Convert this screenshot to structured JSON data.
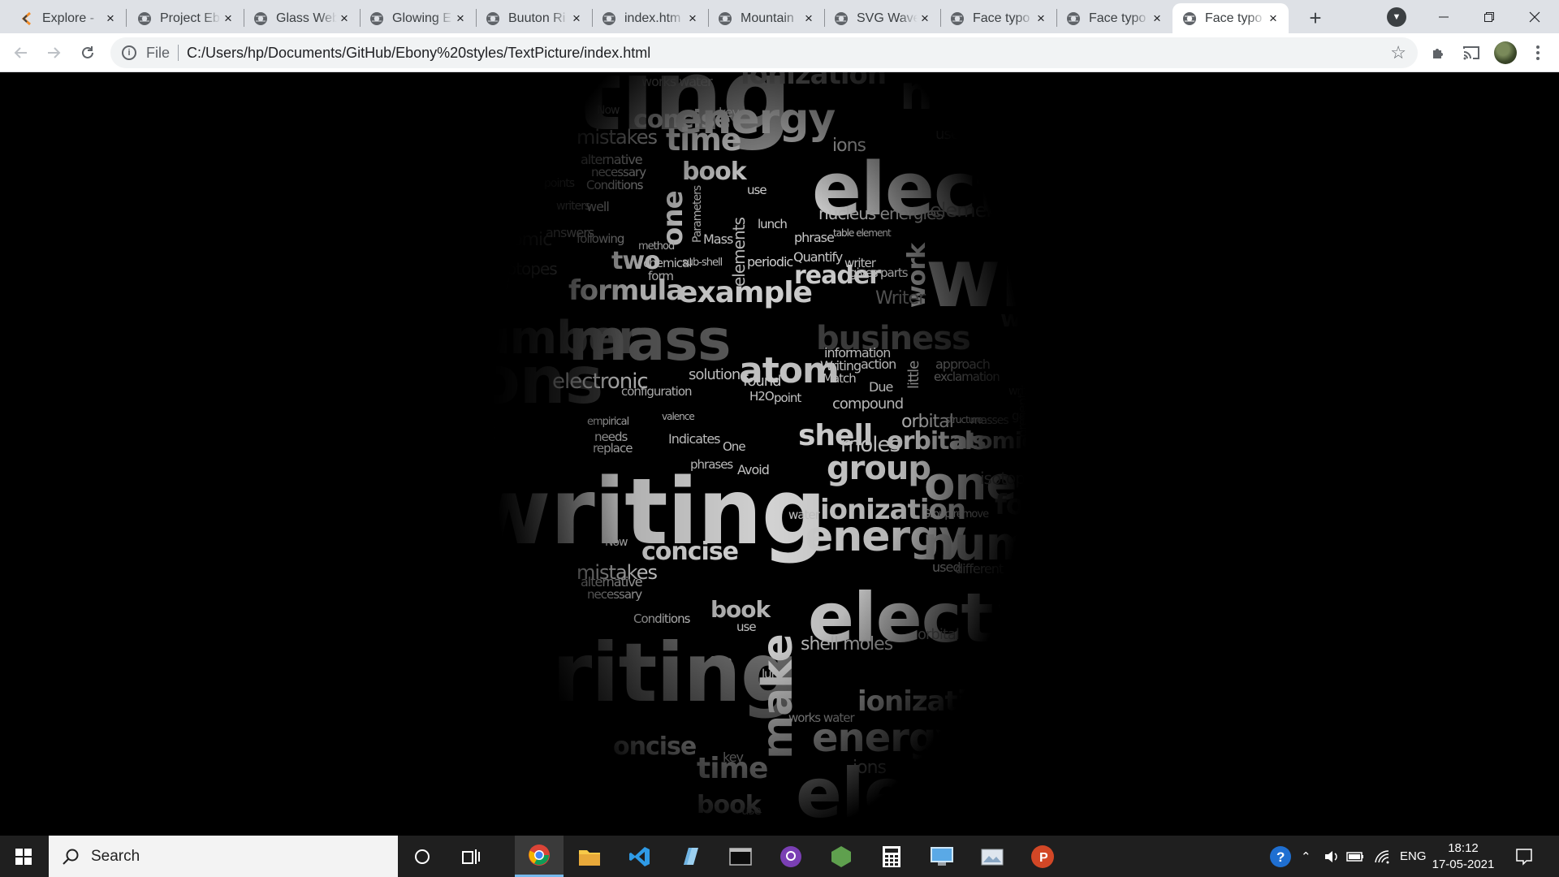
{
  "browser": {
    "tabs": [
      {
        "title": "Explore - ",
        "favicon": "explore-favicon",
        "active": false
      },
      {
        "title": "Project Eb",
        "favicon": "globe-icon",
        "active": false
      },
      {
        "title": "Glass Web",
        "favicon": "globe-icon",
        "active": false
      },
      {
        "title": "Glowing E",
        "favicon": "globe-icon",
        "active": false
      },
      {
        "title": "Buuton Ri",
        "favicon": "globe-icon",
        "active": false
      },
      {
        "title": "index.htm",
        "favicon": "globe-icon",
        "active": false
      },
      {
        "title": "Mountain",
        "favicon": "globe-icon",
        "active": false
      },
      {
        "title": "SVG Wave",
        "favicon": "globe-icon",
        "active": false
      },
      {
        "title": "Face typo",
        "favicon": "globe-icon",
        "active": false
      },
      {
        "title": "Face typo",
        "favicon": "globe-icon",
        "active": false
      },
      {
        "title": "Face typo",
        "favicon": "globe-icon",
        "active": true
      }
    ],
    "new_tab_symbol": "+",
    "address": {
      "scheme_chip": "File",
      "url": "C:/Users/hp/Documents/GitHub/Ebony%20styles/TextPicture/index.html"
    },
    "icons": [
      "back-icon",
      "forward-icon",
      "reload-icon",
      "info-icon",
      "star-icon",
      "extensions-icon",
      "cast-icon",
      "avatar",
      "menu-icon"
    ],
    "window_controls": [
      "minimize",
      "restore",
      "close"
    ]
  },
  "page": {
    "background": "#000000",
    "words": [
      {
        "t": "riting",
        "s": 120,
        "c": "#9a9a9a"
      },
      {
        "t": "works water",
        "s": 16,
        "c": "#bdbdbd"
      },
      {
        "t": "ionization",
        "s": 34,
        "c": "#8a8a8a"
      },
      {
        "t": "Now",
        "s": 14,
        "c": "#cfcfcf"
      },
      {
        "t": "concise",
        "s": 30,
        "c": "#d6d6d6"
      },
      {
        "t": "key",
        "s": 16,
        "c": "#d0d0d0"
      },
      {
        "t": "energy",
        "s": 52,
        "c": "#c4c4c4"
      },
      {
        "t": "num",
        "s": 58,
        "c": "#8a8a8a"
      },
      {
        "t": "mistakes",
        "s": 24,
        "c": "#d4d4d4"
      },
      {
        "t": "time",
        "s": 38,
        "c": "#dadada"
      },
      {
        "t": "make",
        "s": 56,
        "c": "#c8c8c8"
      },
      {
        "t": "ions",
        "s": 22,
        "c": "#cfcfcf"
      },
      {
        "t": "used",
        "s": 18,
        "c": "#9a9a9a"
      },
      {
        "t": "alternative",
        "s": 16,
        "c": "#cacaca"
      },
      {
        "t": "necessary",
        "s": 15,
        "c": "#cacaca"
      },
      {
        "t": "electron",
        "s": 90,
        "c": "#d0d0d0"
      },
      {
        "t": "book",
        "s": 30,
        "c": "#d4d4d4"
      },
      {
        "t": "Conditions",
        "s": 15,
        "c": "#cacaca"
      },
      {
        "t": "points",
        "s": 14,
        "c": "#9e9e9e"
      },
      {
        "t": "Parameters",
        "s": 14,
        "c": "#b8b8b8"
      },
      {
        "t": "use",
        "s": 15,
        "c": "#cfcfcf"
      },
      {
        "t": "writers",
        "s": 14,
        "c": "#a8a8a8"
      },
      {
        "t": "well",
        "s": 16,
        "c": "#bdbdbd"
      },
      {
        "t": "one",
        "s": 34,
        "c": "#c8c8c8"
      },
      {
        "t": "nucleus energies",
        "s": 20,
        "c": "#c8c8c8"
      },
      {
        "t": "element",
        "s": 24,
        "c": "#a8a8a8"
      },
      {
        "t": "answers",
        "s": 16,
        "c": "#bdbdbd"
      },
      {
        "t": "lunch",
        "s": 15,
        "c": "#cfcfcf"
      },
      {
        "t": "phrase",
        "s": 16,
        "c": "#cfcfcf"
      },
      {
        "t": "atomic",
        "s": 22,
        "c": "#8e8e8e"
      },
      {
        "t": "following",
        "s": 15,
        "c": "#b0b0b0"
      },
      {
        "t": "method",
        "s": 13,
        "c": "#c0c0c0"
      },
      {
        "t": "elements",
        "s": 20,
        "c": "#bdbdbd"
      },
      {
        "t": "Mass",
        "s": 16,
        "c": "#cfcfcf"
      },
      {
        "t": "table element",
        "s": 12,
        "c": "#c4c4c4"
      },
      {
        "t": "wri",
        "s": 100,
        "c": "#9a9a9a"
      },
      {
        "t": "two",
        "s": 30,
        "c": "#cfcfcf"
      },
      {
        "t": "chemical",
        "s": 15,
        "c": "#cfcfcf"
      },
      {
        "t": "sub-shell",
        "s": 13,
        "c": "#c4c4c4"
      },
      {
        "t": "periodic",
        "s": 16,
        "c": "#cfcfcf"
      },
      {
        "t": "Quantify",
        "s": 16,
        "c": "#cfcfcf"
      },
      {
        "t": "writer",
        "s": 15,
        "c": "#cfcfcf"
      },
      {
        "t": "one",
        "s": 44,
        "c": "#6e6e6e"
      },
      {
        "t": "isotopes",
        "s": 20,
        "c": "#8a8a8a"
      },
      {
        "t": "form",
        "s": 15,
        "c": "#bdbdbd"
      },
      {
        "t": "reader",
        "s": 30,
        "c": "#d4d4d4"
      },
      {
        "t": "gives",
        "s": 15,
        "c": "#cfcfcf"
      },
      {
        "t": "parts",
        "s": 15,
        "c": "#cfcfcf"
      },
      {
        "t": "formula",
        "s": 34,
        "c": "#c8c8c8"
      },
      {
        "t": "example",
        "s": 36,
        "c": "#cfcfcf"
      },
      {
        "t": "work",
        "s": 30,
        "c": "#a8a8a8"
      },
      {
        "t": "Writer",
        "s": 22,
        "c": "#5e5e5e"
      },
      {
        "t": "number",
        "s": 56,
        "c": "#4a4a4a"
      },
      {
        "t": "mass",
        "s": 70,
        "c": "#5a5a5a"
      },
      {
        "t": "business",
        "s": 40,
        "c": "#3e3e3e"
      },
      {
        "t": "word",
        "s": 28,
        "c": "#6e6e6e"
      },
      {
        "t": "trons",
        "s": 80,
        "c": "#3a3a3a"
      },
      {
        "t": "atom",
        "s": 44,
        "c": "#c4c4c4"
      },
      {
        "t": "information",
        "s": 16,
        "c": "#cacaca"
      },
      {
        "t": "Writing",
        "s": 16,
        "c": "#cacaca"
      },
      {
        "t": "action",
        "s": 16,
        "c": "#cacaca"
      },
      {
        "t": "little",
        "s": 18,
        "c": "#a8a8a8"
      },
      {
        "t": "approach",
        "s": 16,
        "c": "#8a8a8a"
      },
      {
        "t": "electronic",
        "s": 26,
        "c": "#c8c8c8"
      },
      {
        "t": "solution",
        "s": 18,
        "c": "#c8c8c8"
      },
      {
        "t": "found",
        "s": 18,
        "c": "#c8c8c8"
      },
      {
        "t": "Match",
        "s": 15,
        "c": "#cacaca"
      },
      {
        "t": "Due",
        "s": 16,
        "c": "#cacaca"
      },
      {
        "t": "exclamation",
        "s": 15,
        "c": "#8a8a8a"
      },
      {
        "t": "configuration",
        "s": 15,
        "c": "#c4c4c4"
      },
      {
        "t": "H2O",
        "s": 15,
        "c": "#c4c4c4"
      },
      {
        "t": "point",
        "s": 15,
        "c": "#c4c4c4"
      },
      {
        "t": "compound",
        "s": 18,
        "c": "#c8c8c8"
      },
      {
        "t": "writers",
        "s": 14,
        "c": "#8a8a8a"
      },
      {
        "t": "element",
        "s": 26,
        "c": "#3e3e3e"
      },
      {
        "t": "empirical",
        "s": 13,
        "c": "#bdbdbd"
      },
      {
        "t": "valence",
        "s": 12,
        "c": "#bdbdbd"
      },
      {
        "t": "orbital",
        "s": 22,
        "c": "#c4c4c4"
      },
      {
        "t": "structure",
        "s": 12,
        "c": "#b0b0b0"
      },
      {
        "t": "masses",
        "s": 14,
        "c": "#9a9a9a"
      },
      {
        "t": "game",
        "s": 15,
        "c": "#9a9a9a"
      },
      {
        "t": "needs",
        "s": 15,
        "c": "#c4c4c4"
      },
      {
        "t": "replace",
        "s": 15,
        "c": "#c4c4c4"
      },
      {
        "t": "Indicates",
        "s": 16,
        "c": "#cacaca"
      },
      {
        "t": "One",
        "s": 15,
        "c": "#cacaca"
      },
      {
        "t": "shell",
        "s": 36,
        "c": "#d4d4d4"
      },
      {
        "t": "moles",
        "s": 26,
        "c": "#cfcfcf"
      },
      {
        "t": "orbitals",
        "s": 30,
        "c": "#c8c8c8"
      },
      {
        "t": "atomic",
        "s": 28,
        "c": "#c4c4c4"
      },
      {
        "t": "present",
        "s": 16,
        "c": "#8a8a8a"
      },
      {
        "t": "phrases",
        "s": 15,
        "c": "#c4c4c4"
      },
      {
        "t": "Avoid",
        "s": 16,
        "c": "#c4c4c4"
      },
      {
        "t": "group",
        "s": 40,
        "c": "#cfcfcf"
      },
      {
        "t": "one",
        "s": 56,
        "c": "#d0d0d0"
      },
      {
        "t": "isotopes",
        "s": 20,
        "c": "#8a8a8a"
      },
      {
        "t": "writing",
        "s": 112,
        "c": "#d2d2d2"
      },
      {
        "t": "ionization",
        "s": 34,
        "c": "#c8c8c8"
      },
      {
        "t": "formula",
        "s": 34,
        "c": "#6e6e6e"
      },
      {
        "t": "water",
        "s": 15,
        "c": "#c4c4c4"
      },
      {
        "t": "Group remove",
        "s": 13,
        "c": "#bdbdbd"
      },
      {
        "t": "energy",
        "s": 52,
        "c": "#cfcfcf"
      },
      {
        "t": "number",
        "s": 56,
        "c": "#bcbcbc"
      },
      {
        "t": "Now",
        "s": 14,
        "c": "#cfcfcf"
      },
      {
        "t": "concise",
        "s": 30,
        "c": "#d6d6d6"
      },
      {
        "t": "mistakes",
        "s": 24,
        "c": "#d4d4d4"
      },
      {
        "t": "used",
        "s": 16,
        "c": "#b8b8b8"
      },
      {
        "t": "different",
        "s": 16,
        "c": "#9a9a9a"
      },
      {
        "t": "alternative",
        "s": 16,
        "c": "#c8c8c8"
      },
      {
        "t": "necessary",
        "s": 15,
        "c": "#c8c8c8"
      },
      {
        "t": "electrons",
        "s": 84,
        "c": "#c8c8c8"
      },
      {
        "t": "book",
        "s": 28,
        "c": "#b4b4b4"
      },
      {
        "t": "Conditions",
        "s": 15,
        "c": "#c4c4c4"
      },
      {
        "t": "use",
        "s": 15,
        "c": "#c4c4c4"
      },
      {
        "t": "orbital",
        "s": 18,
        "c": "#8a8a8a"
      },
      {
        "t": "shell moles",
        "s": 22,
        "c": "#bdbdbd"
      },
      {
        "t": "One",
        "s": 15,
        "c": "#bdbdbd"
      },
      {
        "t": "lunch",
        "s": 15,
        "c": "#c4c4c4"
      },
      {
        "t": "riting",
        "s": 100,
        "c": "#6a6a6a"
      },
      {
        "t": "ionization",
        "s": 34,
        "c": "#c4c4c4"
      },
      {
        "t": "works water",
        "s": 15,
        "c": "#bdbdbd"
      },
      {
        "t": "one",
        "s": 56,
        "c": "#6a6a6a"
      },
      {
        "t": "energy",
        "s": 48,
        "c": "#c4c4c4"
      },
      {
        "t": "oncise",
        "s": 30,
        "c": "#cfcfcf"
      },
      {
        "t": "key",
        "s": 16,
        "c": "#c4c4c4"
      },
      {
        "t": "time",
        "s": 36,
        "c": "#cfcfcf"
      },
      {
        "t": "make",
        "s": 52,
        "c": "#c8c8c8"
      },
      {
        "t": "ions",
        "s": 22,
        "c": "#bdbdbd"
      },
      {
        "t": "elec",
        "s": 84,
        "c": "#cfcfcf"
      },
      {
        "t": "book",
        "s": 30,
        "c": "#c8c8c8"
      },
      {
        "t": "use",
        "s": 15,
        "c": "#bdbdbd"
      }
    ]
  },
  "taskbar": {
    "search_placeholder": "Search",
    "pinned_apps": [
      "cortana-icon",
      "task-view-icon",
      "chrome-icon",
      "file-explorer-icon",
      "vscode-icon",
      "notepad-icon",
      "terminal-icon",
      "github-desktop-icon",
      "nodejs-icon",
      "calculator-icon",
      "remote-desktop-icon",
      "photos-icon",
      "powerpoint-icon"
    ],
    "tray": {
      "language": "ENG",
      "time": "18:12",
      "date": "17-05-2021"
    }
  },
  "colors": {
    "tabstrip": "#dee1e6",
    "toolbar": "#ffffff",
    "taskbar": "#1f1f1f",
    "taskbar_search": "#f3f3f3",
    "active_task_underline": "#76b9ed"
  }
}
